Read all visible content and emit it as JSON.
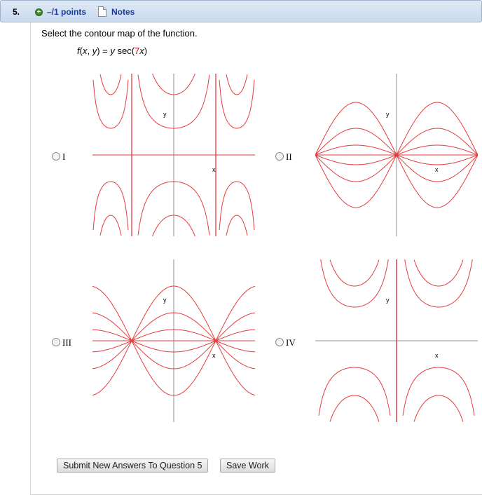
{
  "question": {
    "number": "5.",
    "points": "–/1 points",
    "notes": "Notes",
    "prompt": "Select the contour map of the function.",
    "function": {
      "lhs_f": "f",
      "lhs_x": "x",
      "lhs_y": "y",
      "rhs_y": "y",
      "sec": " sec(",
      "coef": "7",
      "var": "x",
      "close": ")"
    }
  },
  "choices": [
    {
      "label": "I",
      "selected": false,
      "x_axis_label": "x",
      "y_axis_label": "y"
    },
    {
      "label": "II",
      "selected": false,
      "x_axis_label": "x",
      "y_axis_label": "y"
    },
    {
      "label": "III",
      "selected": false,
      "x_axis_label": "x",
      "y_axis_label": "y"
    },
    {
      "label": "IV",
      "selected": false,
      "x_axis_label": "x",
      "y_axis_label": "y"
    }
  ],
  "buttons": {
    "submit": "Submit New Answers To Question 5",
    "save": "Save Work"
  },
  "colors": {
    "contour": "#e53b3b",
    "axis": "#8c8c8c",
    "header_link": "#1a3a9a"
  }
}
